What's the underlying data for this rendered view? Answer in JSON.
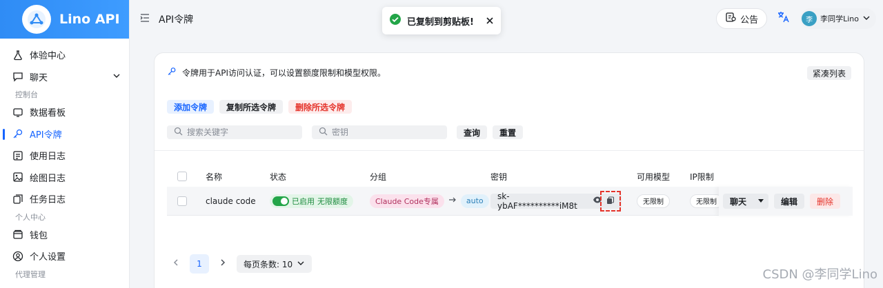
{
  "brand": {
    "title": "Lino API"
  },
  "sidebar": {
    "items": [
      {
        "label": "体验中心",
        "icon": "flask-icon"
      },
      {
        "label": "聊天",
        "icon": "chat-icon"
      }
    ],
    "section_console": "控制台",
    "console_items": [
      {
        "label": "数据看板",
        "icon": "dashboard-icon"
      },
      {
        "label": "API令牌",
        "icon": "key-icon",
        "active": true
      },
      {
        "label": "使用日志",
        "icon": "log-icon"
      },
      {
        "label": "绘图日志",
        "icon": "image-icon"
      },
      {
        "label": "任务日志",
        "icon": "task-icon"
      }
    ],
    "section_personal": "个人中心",
    "personal_items": [
      {
        "label": "钱包",
        "icon": "wallet-icon"
      },
      {
        "label": "个人设置",
        "icon": "user-icon"
      }
    ],
    "section_admin": "代理管理"
  },
  "topbar": {
    "title": "API令牌",
    "notice_label": "公告",
    "user_initial": "李",
    "user_name": "李同学Lino"
  },
  "toast": {
    "message": "已复制到剪贴板!"
  },
  "card": {
    "description": "令牌用于API访问认证，可以设置额度限制和模型权限。",
    "compact_label": "紧凑列表",
    "add_label": "添加令牌",
    "copy_selected_label": "复制所选令牌",
    "delete_selected_label": "删除所选令牌",
    "search_placeholder": "搜索关键字",
    "key_placeholder": "密钥",
    "query_label": "查询",
    "reset_label": "重置"
  },
  "table": {
    "headers": {
      "name": "名称",
      "status": "状态",
      "group": "分组",
      "key": "密钥",
      "models": "可用模型",
      "ip": "IP限制"
    },
    "rows": [
      {
        "name": "claude code",
        "status": "已启用",
        "quota": "无限额度",
        "group": "Claude Code专属",
        "group_target": "auto",
        "key": "sk-ybAF**********iM8t",
        "models": "无限制",
        "ip": "无限制",
        "chat_label": "聊天",
        "edit_label": "编辑",
        "delete_label": "删除"
      }
    ]
  },
  "pagination": {
    "current": "1",
    "page_size_label": "每页条数: 10"
  },
  "watermark": "CSDN @李同学Lino"
}
